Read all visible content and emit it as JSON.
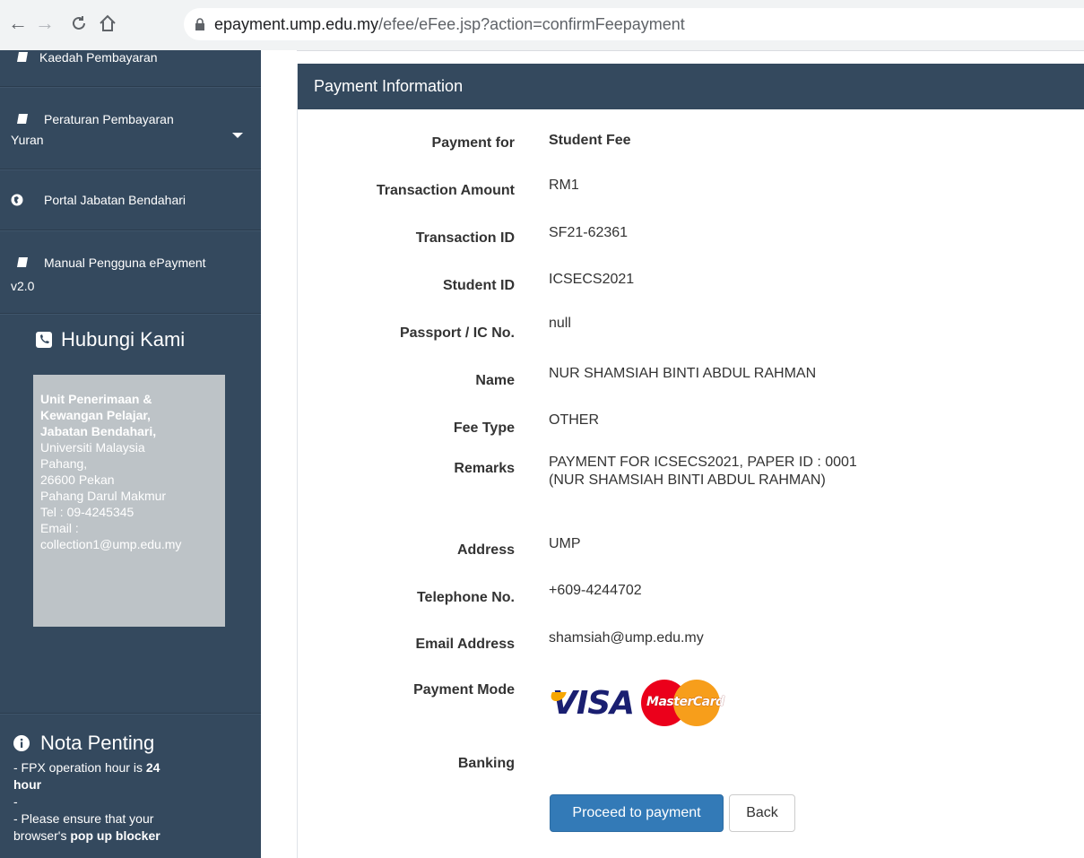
{
  "browser": {
    "url_host": "epayment.ump.edu.my",
    "url_path": "/efee/eFee.jsp?action=confirmFeepayment"
  },
  "sidebar": {
    "items": [
      {
        "label": "Kaedah Pembayaran",
        "icon": "book-icon"
      },
      {
        "label_line1": "Peraturan Pembayaran",
        "label_line2": "Yuran",
        "icon": "book-icon"
      },
      {
        "label": "Portal Jabatan Bendahari",
        "icon": "globe-icon"
      },
      {
        "label_line1": "Manual Pengguna ePayment",
        "label_line2": "v2.0",
        "icon": "book-icon"
      }
    ],
    "contact": {
      "title": "Hubungi Kami",
      "lines_bold": [
        "Unit Penerimaan &",
        "Kewangan Pelajar,",
        "Jabatan Bendahari,"
      ],
      "lines": [
        "Universiti Malaysia",
        "Pahang,",
        "26600 Pekan",
        "Pahang Darul Makmur",
        "Tel : 09-4245345",
        "Email :",
        "collection1@ump.edu.my"
      ]
    },
    "note": {
      "title": "Nota Penting",
      "line1_a": "- FPX operation hour is ",
      "line1_b": "24",
      "line2": "hour",
      "line3": "-",
      "line4": "- Please ensure that your",
      "line5_a": "browser's ",
      "line5_b": "pop up blocker"
    }
  },
  "panel": {
    "title": "Payment Information",
    "fields": {
      "payment_for": {
        "label": "Payment for",
        "value": "Student Fee"
      },
      "amount": {
        "label": "Transaction Amount",
        "value": "RM1"
      },
      "transaction_id": {
        "label": "Transaction ID",
        "value": "SF21-62361"
      },
      "student_id": {
        "label": "Student ID",
        "value": "ICSECS2021"
      },
      "passport": {
        "label": "Passport / IC No.",
        "value": "null"
      },
      "name": {
        "label": "Name",
        "value": "NUR SHAMSIAH BINTI ABDUL RAHMAN"
      },
      "fee_type": {
        "label": "Fee Type",
        "value": "OTHER"
      },
      "remarks": {
        "label": "Remarks",
        "value": "PAYMENT FOR ICSECS2021, PAPER ID : 0001 (NUR SHAMSIAH BINTI ABDUL RAHMAN)"
      },
      "address": {
        "label": "Address",
        "value": "UMP"
      },
      "telephone": {
        "label": "Telephone No.",
        "value": "+609-4244702"
      },
      "email": {
        "label": "Email Address",
        "value": "shamsiah@ump.edu.my"
      },
      "payment_mode": {
        "label": "Payment Mode",
        "visa": "VISA",
        "mastercard": "MasterCard"
      },
      "banking": {
        "label": "Banking"
      }
    },
    "buttons": {
      "proceed": "Proceed to payment",
      "back": "Back"
    }
  }
}
